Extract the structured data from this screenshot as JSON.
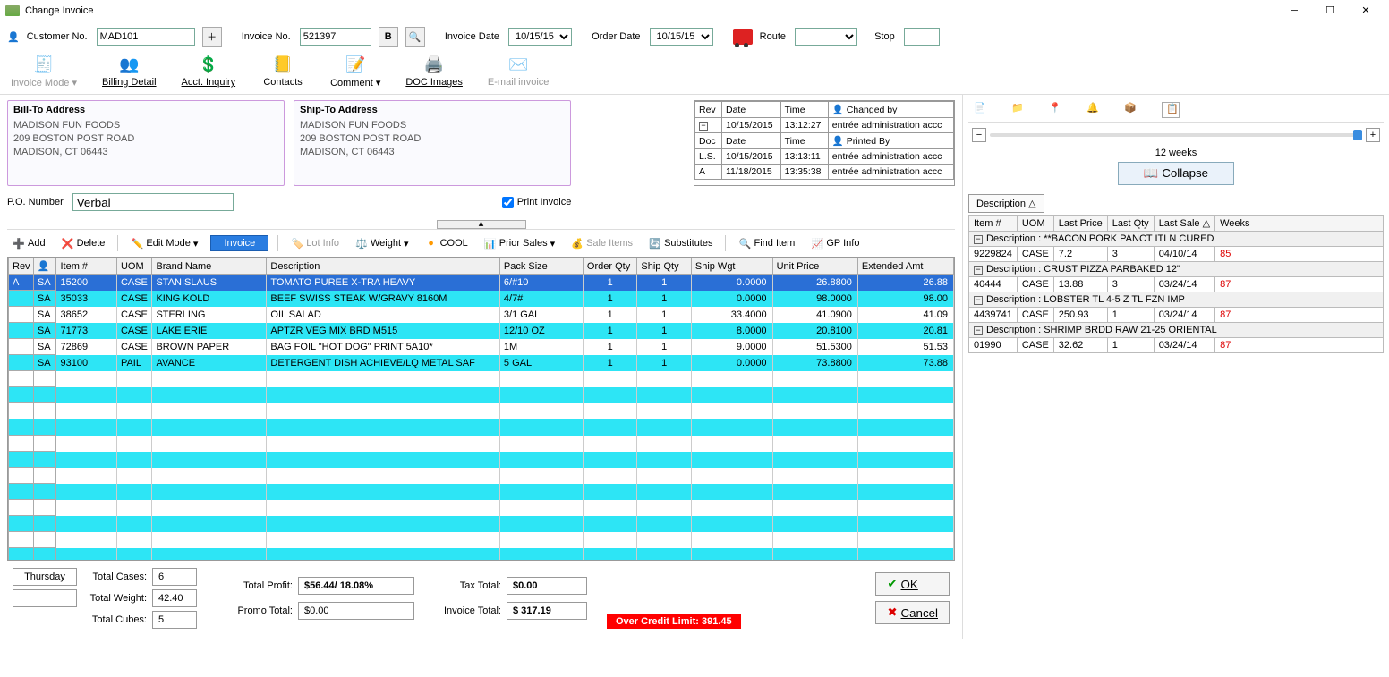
{
  "window": {
    "title": "Change Invoice"
  },
  "header": {
    "customer_no_label": "Customer No.",
    "customer_no": "MAD101",
    "invoice_no_label": "Invoice No.",
    "invoice_no": "521397",
    "b_btn": "B",
    "invoice_date_label": "Invoice Date",
    "invoice_date": "10/15/15",
    "order_date_label": "Order Date",
    "order_date": "10/15/15",
    "route_label": "Route",
    "route": "",
    "stop_label": "Stop",
    "stop": ""
  },
  "ribbon": {
    "invoice_mode": "Invoice Mode",
    "billing_detail": "Billing Detail",
    "acct_inquiry": "Acct. Inquiry",
    "contacts": "Contacts",
    "comment": "Comment",
    "doc_images": "DOC Images",
    "email_invoice": "E-mail invoice"
  },
  "bill_to": {
    "heading": "Bill-To Address",
    "line1": "MADISON FUN FOODS",
    "line2": "209 BOSTON POST ROAD",
    "line3": "MADISON, CT  06443"
  },
  "ship_to": {
    "heading": "Ship-To Address",
    "line1": "MADISON FUN FOODS",
    "line2": "209 BOSTON POST ROAD",
    "line3": "MADISON, CT  06443"
  },
  "audit": {
    "h_rev": "Rev",
    "h_date": "Date",
    "h_time": "Time",
    "h_changed": "Changed by",
    "h_doc": "Doc",
    "h_printed": "Printed By",
    "r1_date": "10/15/2015",
    "r1_time": "13:12:27",
    "r1_by": "entrée administration accc",
    "ls": "L.S.",
    "r2_date": "10/15/2015",
    "r2_time": "13:13:11",
    "r2_by": "entrée administration accc",
    "r3_rev": "A",
    "r3_date": "11/18/2015",
    "r3_time": "13:35:38",
    "r3_by": "entrée administration accc"
  },
  "po": {
    "label": "P.O. Number",
    "value": "Verbal",
    "print_label": "Print Invoice",
    "print_checked": true
  },
  "toolbar": {
    "add": "Add",
    "delete": "Delete",
    "edit_mode": "Edit Mode",
    "mode_value": "Invoice",
    "lot_info": "Lot Info",
    "weight": "Weight",
    "cool": "COOL",
    "prior_sales": "Prior Sales",
    "sale_items": "Sale Items",
    "substitutes": "Substitutes",
    "find_item": "Find Item",
    "gp_info": "GP Info"
  },
  "grid": {
    "cols": {
      "rev": "Rev",
      "src": "",
      "item": "Item #",
      "uom": "UOM",
      "brand": "Brand Name",
      "desc": "Description",
      "pack": "Pack Size",
      "oqty": "Order Qty",
      "sqty": "Ship Qty",
      "swgt": "Ship Wgt",
      "uprice": "Unit Price",
      "ext": "Extended Amt"
    },
    "rows": [
      {
        "rev": "A",
        "src": "SA",
        "item": "15200",
        "uom": "CASE",
        "brand": "STANISLAUS",
        "desc": "TOMATO PUREE X-TRA HEAVY",
        "pack": "6/#10",
        "oqty": "1",
        "sqty": "1",
        "swgt": "0.0000",
        "uprice": "26.8800",
        "ext": "26.88",
        "cls": "selected"
      },
      {
        "rev": "",
        "src": "SA",
        "item": "35033",
        "uom": "CASE",
        "brand": "KING KOLD",
        "desc": "BEEF SWISS STEAK W/GRAVY 8160M",
        "pack": "4/7#",
        "oqty": "1",
        "sqty": "1",
        "swgt": "0.0000",
        "uprice": "98.0000",
        "ext": "98.00",
        "cls": "cyan"
      },
      {
        "rev": "",
        "src": "SA",
        "item": "38652",
        "uom": "CASE",
        "brand": "STERLING",
        "desc": "OIL SALAD",
        "pack": "3/1 GAL",
        "oqty": "1",
        "sqty": "1",
        "swgt": "33.4000",
        "uprice": "41.0900",
        "ext": "41.09",
        "cls": "white"
      },
      {
        "rev": "",
        "src": "SA",
        "item": "71773",
        "uom": "CASE",
        "brand": "LAKE ERIE",
        "desc": "APTZR VEG MIX BRD M515",
        "pack": "12/10 OZ",
        "oqty": "1",
        "sqty": "1",
        "swgt": "8.0000",
        "uprice": "20.8100",
        "ext": "20.81",
        "cls": "cyan"
      },
      {
        "rev": "",
        "src": "SA",
        "item": "72869",
        "uom": "CASE",
        "brand": "BROWN PAPER",
        "desc": "BAG FOIL \"HOT DOG\" PRINT 5A10*",
        "pack": "1M",
        "oqty": "1",
        "sqty": "1",
        "swgt": "9.0000",
        "uprice": "51.5300",
        "ext": "51.53",
        "cls": "white"
      },
      {
        "rev": "",
        "src": "SA",
        "item": "93100",
        "uom": "PAIL",
        "brand": "AVANCE",
        "desc": "DETERGENT DISH ACHIEVE/LQ METAL SAF",
        "pack": "5 GAL",
        "oqty": "1",
        "sqty": "1",
        "swgt": "0.0000",
        "uprice": "73.8800",
        "ext": "73.88",
        "cls": "cyan"
      }
    ]
  },
  "footer": {
    "day": "Thursday",
    "cases_lbl": "Total Cases:",
    "cases": "6",
    "weight_lbl": "Total Weight:",
    "weight": "42.40",
    "cubes_lbl": "Total Cubes:",
    "cubes": "5",
    "profit_lbl": "Total Profit:",
    "profit": "$56.44/ 18.08%",
    "promo_lbl": "Promo Total:",
    "promo": "$0.00",
    "tax_lbl": "Tax Total:",
    "tax": "$0.00",
    "inv_lbl": "Invoice Total:",
    "inv": "$ 317.19",
    "credit": "Over Credit Limit: 391.45",
    "ok": "OK",
    "cancel": "Cancel"
  },
  "right": {
    "weeks_label": "12 weeks",
    "collapse": "Collapse",
    "desc_hdr": "Description",
    "cols": {
      "item": "Item #",
      "uom": "UOM",
      "lprice": "Last Price",
      "lqty": "Last Qty",
      "lsale": "Last Sale",
      "wks": "Weeks"
    },
    "groups": [
      {
        "title": "Description : **BACON  PORK PANCT ITLN CURED",
        "item": "9229824",
        "uom": "CASE",
        "lprice": "7.2",
        "lqty": "3",
        "lsale": "04/10/14",
        "wks": "85"
      },
      {
        "title": "Description : CRUST PIZZA PARBAKED 12\"",
        "item": "40444",
        "uom": "CASE",
        "lprice": "13.88",
        "lqty": "3",
        "lsale": "03/24/14",
        "wks": "87"
      },
      {
        "title": "Description : LOBSTER TL 4-5 Z TL FZN IMP",
        "item": "4439741",
        "uom": "CASE",
        "lprice": "250.93",
        "lqty": "1",
        "lsale": "03/24/14",
        "wks": "87"
      },
      {
        "title": "Description : SHRIMP BRDD RAW 21-25 ORIENTAL",
        "item": "01990",
        "uom": "CASE",
        "lprice": "32.62",
        "lqty": "1",
        "lsale": "03/24/14",
        "wks": "87"
      }
    ]
  }
}
